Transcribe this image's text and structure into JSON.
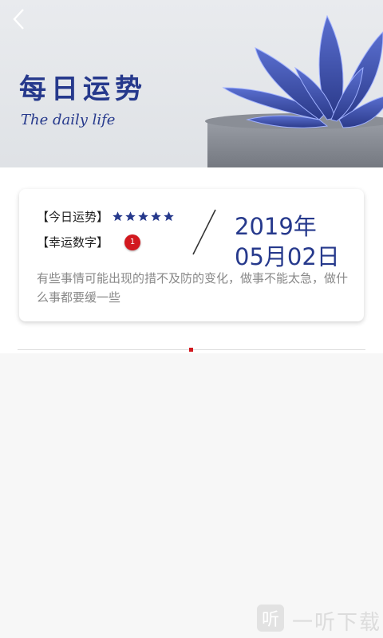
{
  "header": {
    "back_icon": "chevron-left-icon",
    "title": "每日运势",
    "subtitle": "The daily life"
  },
  "card": {
    "luck_label": "【今日运势】",
    "luck_stars": 5,
    "lucky_number_label": "【幸运数字】",
    "lucky_number": "1",
    "date_year": "2019年",
    "date_day": "05月02日",
    "fortune_text": "有些事情可能出现的措不及防的变化，做事不能太急，做什么事都要缓一些"
  },
  "watermark": {
    "icon_glyph": "听",
    "text": "一听下载"
  },
  "colors": {
    "accent": "#26398c",
    "badge": "#d2191f"
  }
}
